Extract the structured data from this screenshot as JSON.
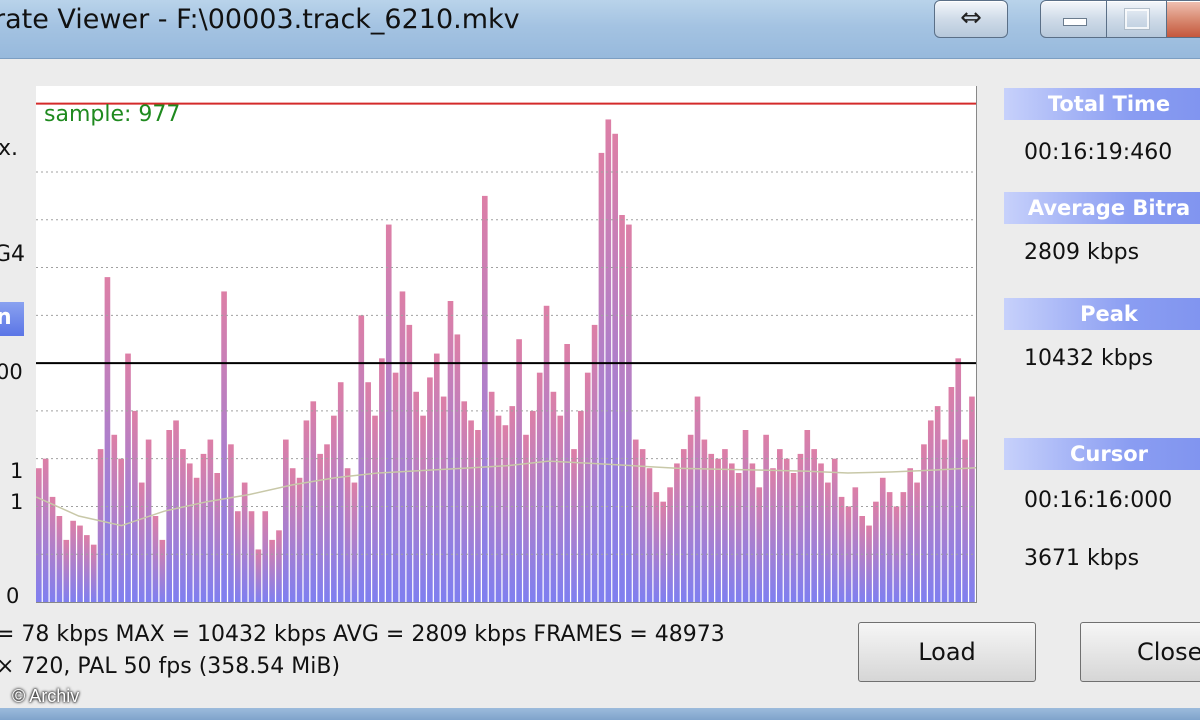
{
  "window": {
    "title": "rate Viewer - F:\\00003.track_6210.mkv",
    "swap_glyph": "⇔",
    "controls": [
      "minimize",
      "maximize",
      "close"
    ]
  },
  "left_partial": {
    "text_x": "x.",
    "text_g4": "G4",
    "blue_label": "n",
    "y_labels": {
      "upper": "00",
      "mid1": "1",
      "mid2": "1",
      "zero": "0"
    }
  },
  "chart": {
    "sample_label": "sample: 977",
    "colors": {
      "bar_top": "#dd7fa6",
      "bar_bottom": "#7f7ff0",
      "max_line": "#d42a2a",
      "ref_line": "#000000",
      "avg_line": "#c8c8a8",
      "grid": "#a0a0a0",
      "sample_label": "#1f8a1f"
    }
  },
  "chart_data": {
    "type": "bar",
    "ylim": [
      0,
      10800
    ],
    "max_line": 10432,
    "reference_line": 5000,
    "grid_lines": [
      1000,
      2000,
      3000,
      4000,
      6000,
      7000,
      8000,
      9000
    ],
    "values": [
      2800,
      3000,
      2200,
      1800,
      1300,
      1700,
      1600,
      1400,
      1200,
      3200,
      6800,
      3500,
      3000,
      5200,
      4000,
      2500,
      3400,
      1800,
      1300,
      3600,
      3800,
      3200,
      2900,
      2600,
      3100,
      3400,
      2700,
      6500,
      3300,
      1900,
      2500,
      1900,
      1100,
      1900,
      1300,
      1500,
      3400,
      2800,
      2600,
      3800,
      4200,
      3100,
      3300,
      3900,
      4600,
      2800,
      2500,
      6000,
      4600,
      3900,
      5100,
      7900,
      4800,
      6500,
      5800,
      4400,
      3900,
      4700,
      5200,
      4300,
      6300,
      5600,
      4200,
      3800,
      3600,
      8500,
      4400,
      3900,
      3700,
      4100,
      5500,
      3500,
      4000,
      4800,
      6200,
      4400,
      3900,
      5400,
      3200,
      4000,
      4800,
      5800,
      9400,
      10100,
      9800,
      8100,
      7900,
      3400,
      3200,
      2800,
      2300,
      2100,
      2400,
      2900,
      3200,
      3500,
      4300,
      3400,
      3100,
      3000,
      3200,
      2900,
      2700,
      3600,
      2900,
      2400,
      3500,
      2800,
      3200,
      3000,
      2700,
      3100,
      3600,
      3200,
      2900,
      2500,
      3000,
      2200,
      2000,
      2400,
      1800,
      1600,
      2100,
      2600,
      2300,
      2000,
      2300,
      2800,
      2500,
      3300,
      3800,
      4100,
      3400,
      4500,
      5100,
      3400,
      4300
    ],
    "average_line": [
      2200,
      1800,
      1600,
      1900,
      2100,
      2250,
      2450,
      2600,
      2700,
      2750,
      2800,
      2850,
      2950,
      2900,
      2850,
      2800,
      2780,
      2760,
      2740,
      2700,
      2720,
      2760,
      2809
    ]
  },
  "right_panel": {
    "total_time_label": "Total Time",
    "total_time_value": "00:16:19:460",
    "avg_bitrate_label": "Average Bitra",
    "avg_bitrate_value": "2809 kbps",
    "peak_label": "Peak",
    "peak_value": "10432 kbps",
    "cursor_label": "Cursor",
    "cursor_time": "00:16:16:000",
    "cursor_bitrate": "3671 kbps"
  },
  "stats": {
    "line1": "= 78 kbps  MAX = 10432 kbps  AVG = 2809 kbps  FRAMES = 48973",
    "line2": "× 720, PAL 50 fps  (358.54 MiB)"
  },
  "buttons": {
    "load": "Load",
    "close": "Close"
  },
  "watermark": "© Archiv"
}
